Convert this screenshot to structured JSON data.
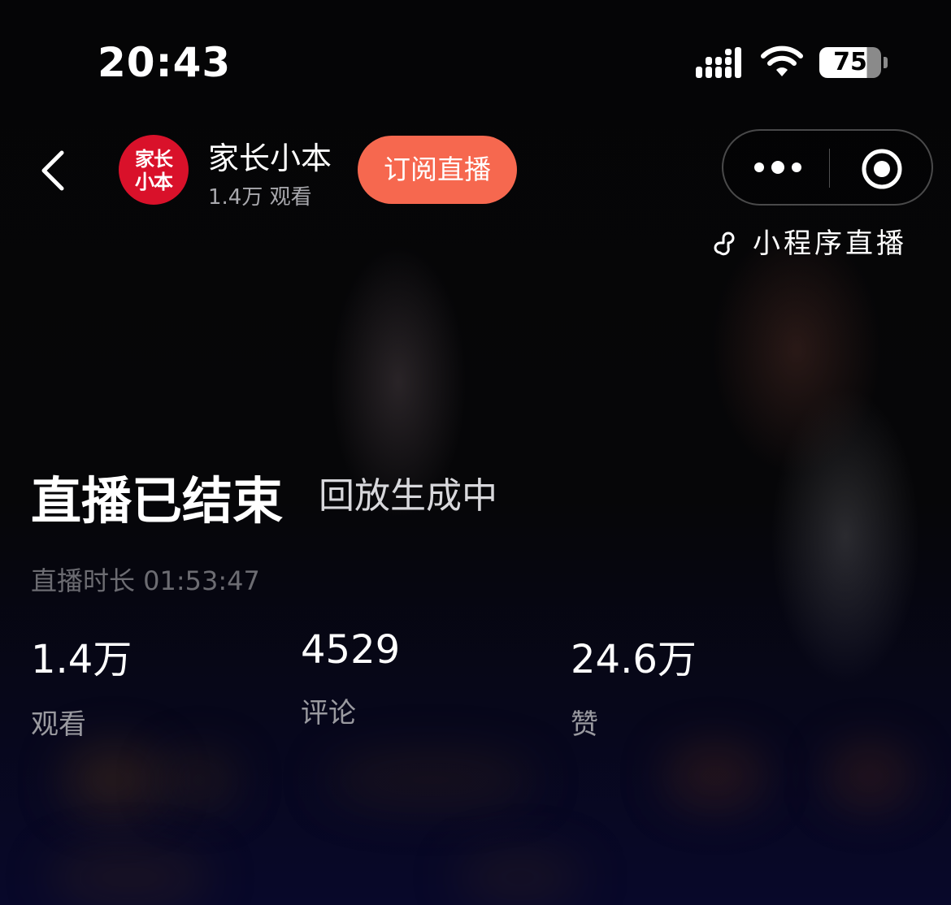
{
  "status_bar": {
    "time": "20:43",
    "battery": "75"
  },
  "header": {
    "avatar_text_line1": "家长",
    "avatar_text_line2": "小本",
    "channel_name": "家长小本",
    "view_count": "1.4万 观看",
    "subscribe_label": "订阅直播",
    "mini_program_label": "小程序直播"
  },
  "main": {
    "title": "直播已结束",
    "replay_status": "回放生成中",
    "duration_text": "直播时长 01:53:47"
  },
  "stats": [
    {
      "value": "1.4万",
      "label": "观看"
    },
    {
      "value": "4529",
      "label": "评论"
    },
    {
      "value": "24.6万",
      "label": "赞"
    }
  ],
  "colors": {
    "subscribe_bg": "#f6684f",
    "avatar_bg": "#d9112a",
    "background": "#050507"
  }
}
